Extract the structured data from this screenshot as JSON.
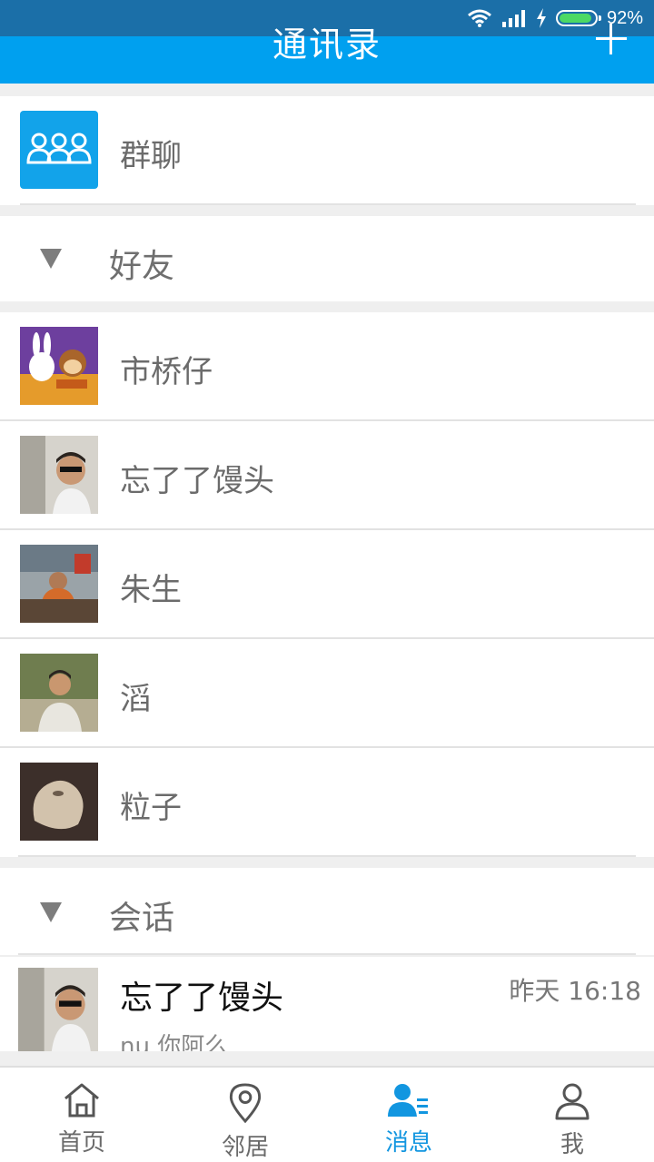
{
  "status_bar": {
    "battery_percent": "92%",
    "battery_level": 0.92
  },
  "header": {
    "title": "通讯录"
  },
  "group_chat": {
    "label": "群聊"
  },
  "sections": {
    "friends": "好友",
    "conversations": "会话"
  },
  "friends": [
    {
      "name": "市桥仔",
      "avatar": "cartoon-rabbit-monkey-avatar"
    },
    {
      "name": "忘了了馒头",
      "avatar": "man-sunglasses-photo"
    },
    {
      "name": "朱生",
      "avatar": "man-at-desk-photo"
    },
    {
      "name": "滔",
      "avatar": "man-outdoor-photo"
    },
    {
      "name": "粒子",
      "avatar": "stone-object-photo"
    }
  ],
  "conversations": [
    {
      "name": "忘了了馒头",
      "time": "昨天 16:18",
      "preview": "nu 你阿么"
    }
  ],
  "tab_bar": [
    {
      "label": "首页",
      "icon": "home-icon",
      "active": false
    },
    {
      "label": "邻居",
      "icon": "location-pin-icon",
      "active": false
    },
    {
      "label": "消息",
      "icon": "contacts-icon",
      "active": true
    },
    {
      "label": "我",
      "icon": "user-icon",
      "active": false
    }
  ],
  "colors": {
    "primary": "#00a0ef",
    "status_bar": "#1b6fa8",
    "active_tab": "#1296e0"
  }
}
